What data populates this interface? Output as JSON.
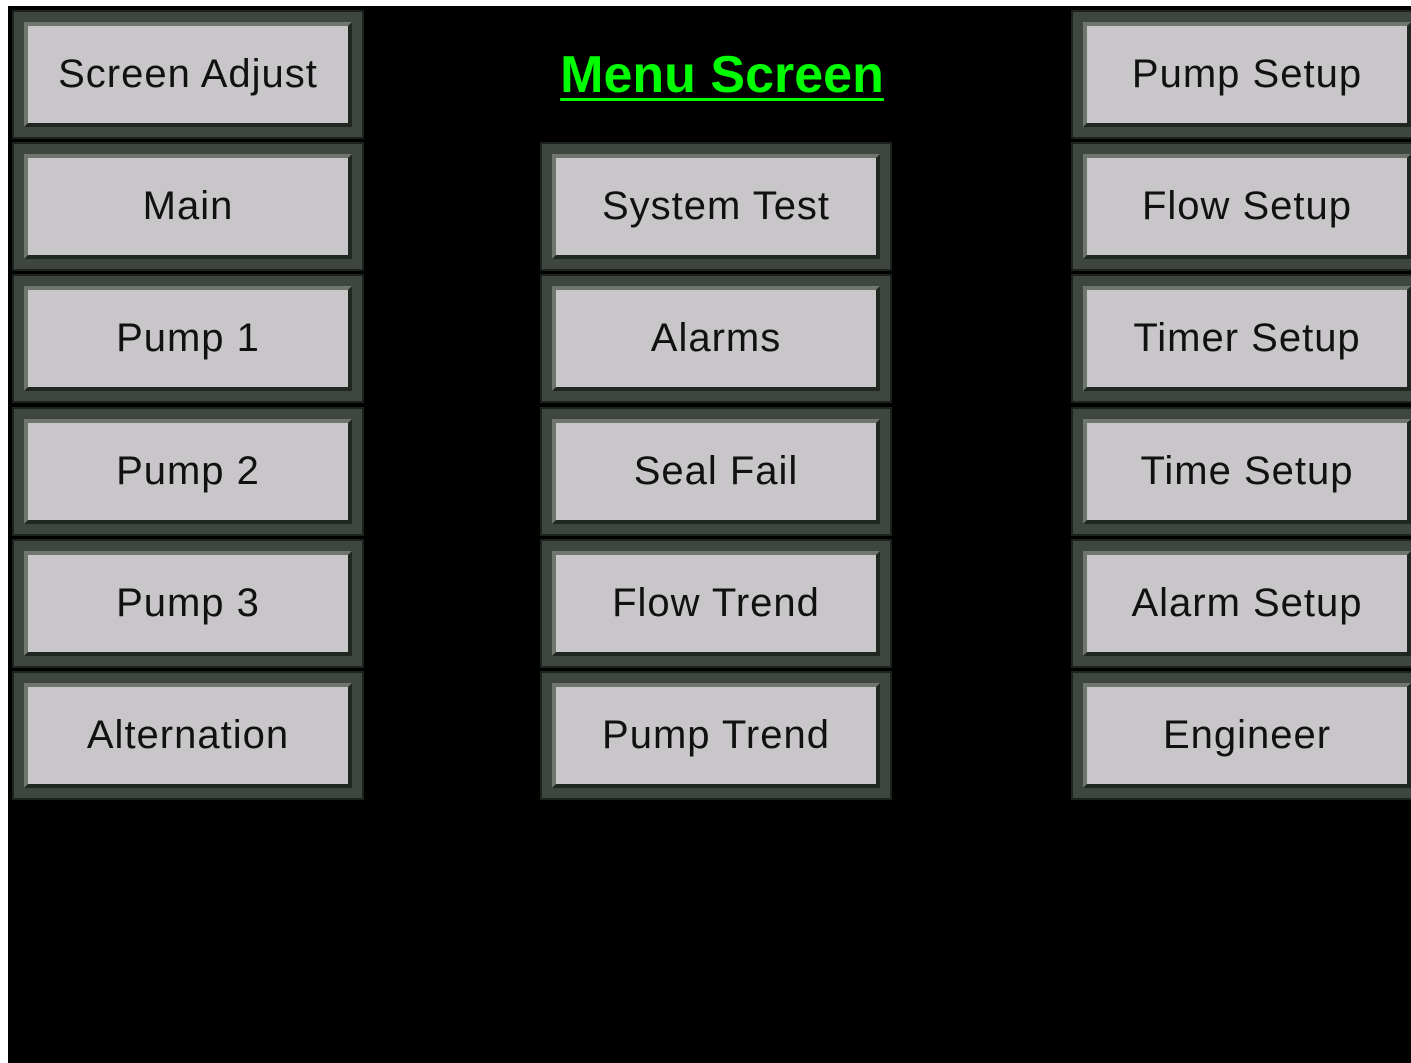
{
  "title": "Menu Screen",
  "colors": {
    "background": "#000000",
    "title": "#00ff00",
    "button_face": "#c9c6c9",
    "button_frame": "#3f463f"
  },
  "left_column": [
    "Screen Adjust",
    "Main",
    "Pump 1",
    "Pump 2",
    "Pump 3",
    "Alternation"
  ],
  "middle_column": [
    "System Test",
    "Alarms",
    "Seal Fail",
    "Flow Trend",
    "Pump Trend"
  ],
  "right_column": [
    "Pump Setup",
    "Flow Setup",
    "Timer Setup",
    "Time Setup",
    "Alarm Setup",
    "Engineer"
  ]
}
